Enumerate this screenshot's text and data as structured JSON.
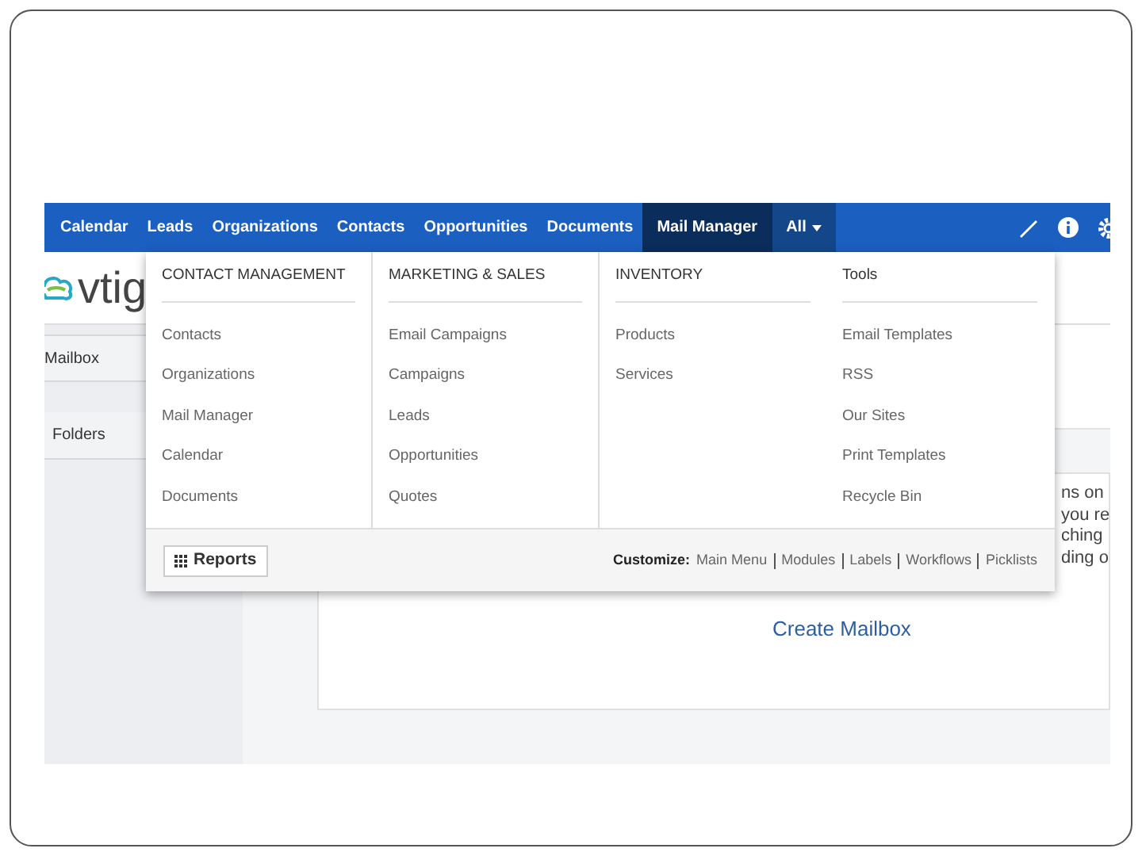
{
  "nav": {
    "items": [
      {
        "label": "Calendar",
        "selected": false,
        "expanded": false
      },
      {
        "label": "Leads",
        "selected": false,
        "expanded": false
      },
      {
        "label": "Organizations",
        "selected": false,
        "expanded": false
      },
      {
        "label": "Contacts",
        "selected": false,
        "expanded": false
      },
      {
        "label": "Opportunities",
        "selected": false,
        "expanded": false
      },
      {
        "label": "Documents",
        "selected": false,
        "expanded": false
      },
      {
        "label": "Mail Manager",
        "selected": true,
        "expanded": false
      },
      {
        "label": "All",
        "selected": false,
        "expanded": true
      }
    ]
  },
  "logo": {
    "text": "vtig"
  },
  "sidebar": {
    "items": [
      "Mailbox",
      "Folders"
    ]
  },
  "dropdown": {
    "columns": [
      {
        "heading": "CONTACT MANAGEMENT",
        "items": [
          "Contacts",
          "Organizations",
          "Mail Manager",
          "Calendar",
          "Documents"
        ]
      },
      {
        "heading": "MARKETING & SALES",
        "items": [
          "Email Campaigns",
          "Campaigns",
          "Leads",
          "Opportunities",
          "Quotes"
        ]
      },
      {
        "heading": "INVENTORY",
        "items": [
          "Products",
          "Services"
        ]
      },
      {
        "heading": "Tools",
        "items": [
          "Email Templates",
          "RSS",
          "Our Sites",
          "Print Templates",
          "Recycle Bin"
        ]
      }
    ],
    "reports_button": "Reports",
    "customize_label": "Customize:",
    "customize_links": [
      "Main Menu",
      "Modules",
      "Labels",
      "Workflows",
      "Picklists"
    ]
  },
  "main": {
    "partial_lines": [
      "ns on",
      "you re",
      "ching",
      "ding o"
    ],
    "link": "Create Mailbox"
  }
}
